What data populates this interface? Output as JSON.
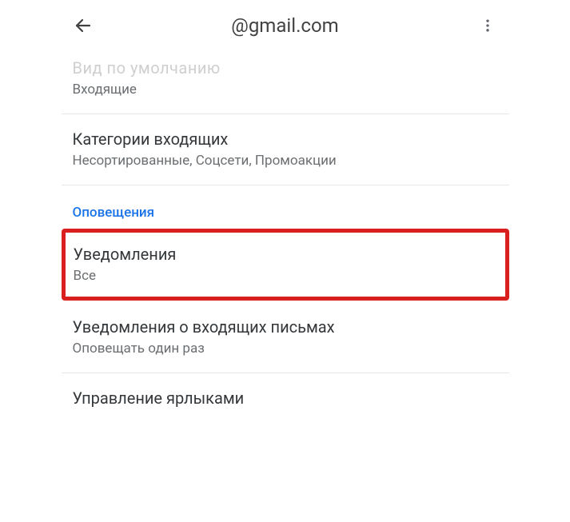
{
  "header": {
    "title": "@gmail.com"
  },
  "rows": {
    "default_view": {
      "label_cut": "Вид по умолчанию",
      "value": "Входящие"
    },
    "inbox_categories": {
      "label": "Категории входящих",
      "value": "Несортированные, Соцсети, Промоакции"
    },
    "section_notifications": "Оповещения",
    "notifications": {
      "label": "Уведомления",
      "value": "Все"
    },
    "incoming_notifications": {
      "label": "Уведомления о входящих письмах",
      "value": "Оповещать один раз"
    },
    "manage_labels": {
      "label": "Управление ярлыками"
    }
  }
}
